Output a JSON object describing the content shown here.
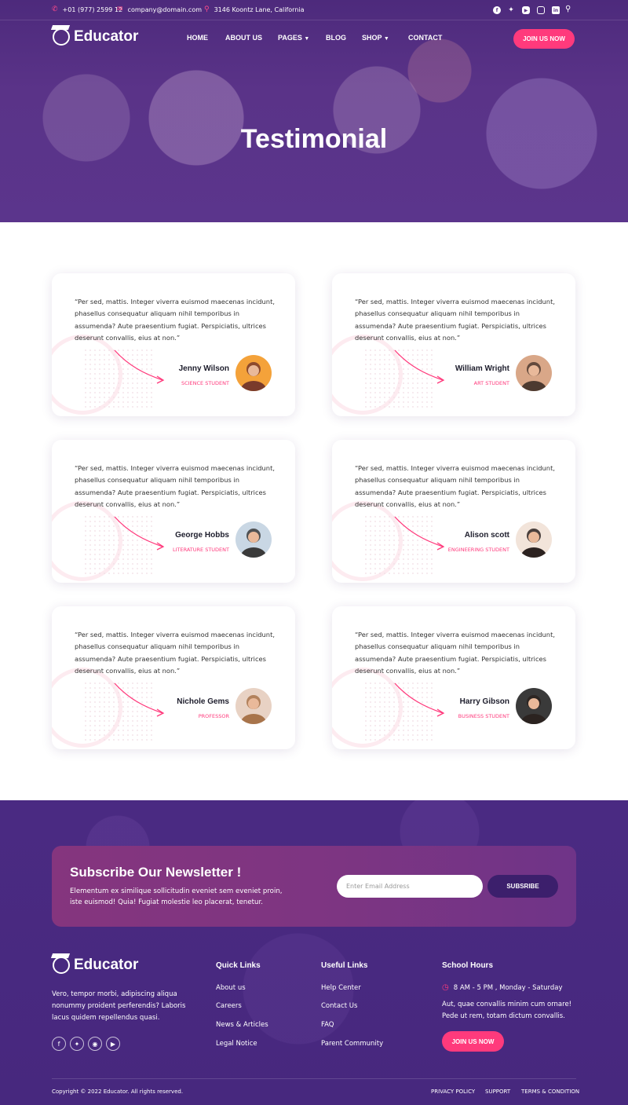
{
  "topbar": {
    "phone": "+01 (977) 2599 12",
    "email": "company@domain.com",
    "address": "3146 Koontz Lane, California",
    "socials": [
      "facebook-icon",
      "twitter-icon",
      "youtube-icon",
      "instagram-icon",
      "linkedin-icon"
    ],
    "search_icon": "search-icon"
  },
  "brand": {
    "name": "Educator"
  },
  "nav": {
    "items": [
      "HOME",
      "ABOUT US",
      "PAGES",
      "BLOG",
      "SHOP",
      "CONTACT"
    ],
    "join_label": "JOIN US NOW"
  },
  "hero": {
    "title": "Testimonial"
  },
  "testimonials": [
    {
      "quote": "“Per sed, mattis. Integer viverra euismod maecenas incidunt, phasellus consequatur aliquam nihil temporibus in assumenda? Aute praesentium fugiat. Perspiciatis, ultrices deserunt convallis, eius at non.”",
      "name": "Jenny Wilson",
      "role": "SCIENCE STUDENT"
    },
    {
      "quote": "“Per sed, mattis. Integer viverra euismod maecenas incidunt, phasellus consequatur aliquam nihil temporibus in assumenda? Aute praesentium fugiat. Perspiciatis, ultrices deserunt convallis, eius at non.”",
      "name": "William Wright",
      "role": "ART STUDENT"
    },
    {
      "quote": "“Per sed, mattis. Integer viverra euismod maecenas incidunt, phasellus consequatur aliquam nihil temporibus in assumenda? Aute praesentium fugiat. Perspiciatis, ultrices deserunt convallis, eius at non.”",
      "name": "George Hobbs",
      "role": "LITERATURE STUDENT"
    },
    {
      "quote": "“Per sed, mattis. Integer viverra euismod maecenas incidunt, phasellus consequatur aliquam nihil temporibus in assumenda? Aute praesentium fugiat. Perspiciatis, ultrices deserunt convallis, eius at non.”",
      "name": "Alison scott",
      "role": "ENGINEERING STUDENT"
    },
    {
      "quote": "“Per sed, mattis. Integer viverra euismod maecenas incidunt, phasellus consequatur aliquam nihil temporibus in assumenda? Aute praesentium fugiat. Perspiciatis, ultrices deserunt convallis, eius at non.”",
      "name": "Nichole Gems",
      "role": "PROFESSOR"
    },
    {
      "quote": "“Per sed, mattis. Integer viverra euismod maecenas incidunt, phasellus consequatur aliquam nihil temporibus in assumenda? Aute praesentium fugiat. Perspiciatis, ultrices deserunt convallis, eius at non.”",
      "name": "Harry Gibson",
      "role": "BUSINESS STUDENT"
    }
  ],
  "newsletter": {
    "title": "Subscribe Our Newsletter !",
    "text": "Elementum ex similique sollicitudin eveniet sem eveniet proin, iste euismod! Quia! Fugiat molestie leo placerat, tenetur.",
    "placeholder": "Enter Email Address",
    "button": "SUBSRIBE"
  },
  "footer": {
    "about": "Vero, tempor morbi, adipiscing aliqua nonummy proident perferendis? Laboris lacus quidem repellendus quasi.",
    "socials": [
      "facebook-icon",
      "twitter-icon",
      "instagram-icon",
      "youtube-icon"
    ],
    "quick_title": "Quick Links",
    "quick_links": [
      "About us",
      "Careers",
      "News & Articles",
      "Legal Notice"
    ],
    "useful_title": "Useful Links",
    "useful_links": [
      "Help Center",
      "Contact Us",
      "FAQ",
      "Parent Community"
    ],
    "hours_title": "School Hours",
    "hours": "8 AM - 5 PM , Monday - Saturday",
    "hours_text": "Aut, quae convallis minim cum ornare! Pede ut rem, totam dictum convallis.",
    "join_label": "JOIN US NOW",
    "copyright": "Copyright © 2022 Educator. All rights reserved.",
    "bottom_links": [
      "PRIVACY POLICY",
      "SUPPORT",
      "TERMS & CONDITION"
    ]
  },
  "colors": {
    "accent": "#ff3a7c",
    "primary": "#4a2a82"
  }
}
